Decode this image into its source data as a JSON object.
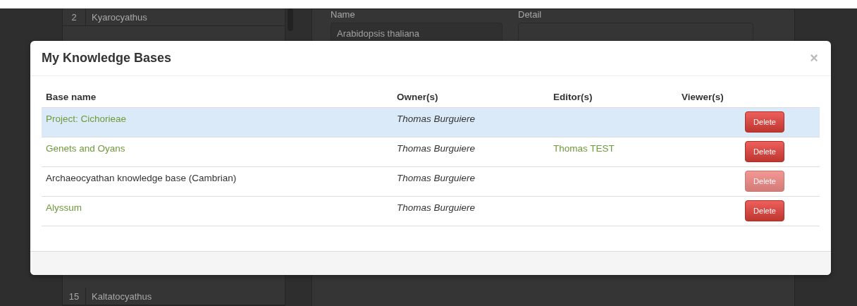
{
  "background": {
    "list": [
      {
        "number": "2",
        "name": "Kyarocyathus"
      },
      {
        "number": "15",
        "name": "Kaltatocyathus"
      }
    ],
    "form": {
      "name_label": "Name",
      "name_value": "Arabidopsis thaliana",
      "detail_label": "Detail"
    }
  },
  "modal": {
    "title": "My Knowledge Bases",
    "close": "×",
    "columns": [
      "Base name",
      "Owner(s)",
      "Editor(s)",
      "Viewer(s)"
    ],
    "rows": [
      {
        "name": "Project: Cichorieae",
        "linked": true,
        "selected": true,
        "owner": "Thomas Burguiere",
        "editor": "",
        "viewer": "",
        "action": "Delete",
        "disabled": false
      },
      {
        "name": "Genets and Oyans",
        "linked": true,
        "selected": false,
        "owner": "Thomas Burguiere",
        "editor": "Thomas TEST",
        "viewer": "",
        "action": "Delete",
        "disabled": false
      },
      {
        "name": "Archaeocyathan knowledge base (Cambrian)",
        "linked": false,
        "selected": false,
        "owner": "Thomas Burguiere",
        "editor": "",
        "viewer": "",
        "action": "Delete",
        "disabled": true
      },
      {
        "name": "Alyssum",
        "linked": true,
        "selected": false,
        "owner": "Thomas Burguiere",
        "editor": "",
        "viewer": "",
        "action": "Delete",
        "disabled": false
      }
    ]
  }
}
